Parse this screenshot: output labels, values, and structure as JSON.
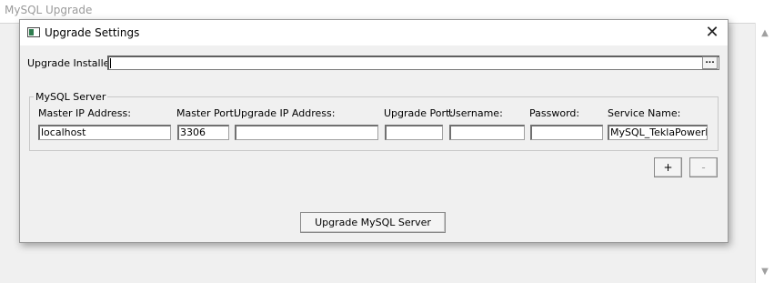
{
  "background_window": {
    "title": "MySQL Upgrade",
    "scroll_up_icon": "▲",
    "scroll_down_icon": "▼"
  },
  "dialog": {
    "title": "Upgrade Settings",
    "close_glyph": "✕",
    "installer_label": "Upgrade Installer:",
    "installer_value": "",
    "browse_label": "...",
    "group_title": "MySQL Server",
    "columns": {
      "master_ip": "Master IP Address:",
      "master_port": "Master Port:",
      "upgrade_ip": "Upgrade IP Address:",
      "upgrade_port": "Upgrade Port:",
      "username": "Username:",
      "password": "Password:",
      "service_name": "Service Name:"
    },
    "row": {
      "master_ip": "localhost",
      "master_port": "3306",
      "upgrade_ip": "",
      "upgrade_port": "",
      "username": "",
      "password": "",
      "service_name": "MySQL_TeklaPowerFab"
    },
    "add_button": "+",
    "remove_button": "-",
    "upgrade_button": "Upgrade MySQL Server"
  }
}
